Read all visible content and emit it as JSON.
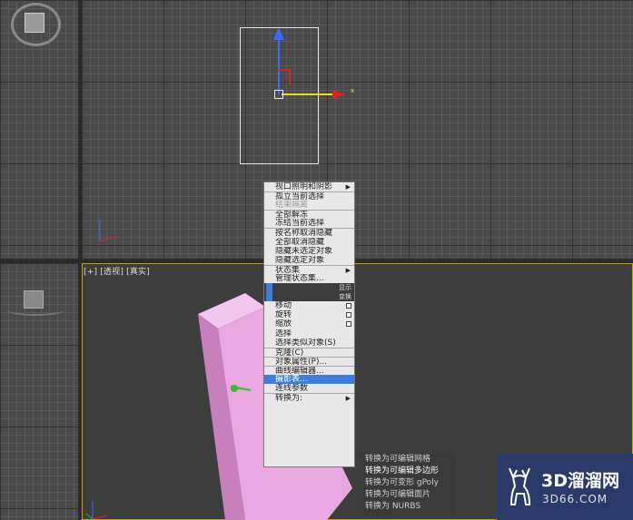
{
  "viewport_persp": {
    "label": "[+] [透视] [真实]"
  },
  "gizmo": {
    "x_label": "x"
  },
  "context_menu": {
    "items": [
      {
        "label": "视口照明和阴影",
        "submenu": true
      },
      {
        "label": "孤立当前选择"
      },
      {
        "label": "结束隔离",
        "disabled": true
      },
      {
        "label": "全部解冻"
      },
      {
        "label": "冻结当前选择"
      },
      {
        "label": "按名称取消隐藏"
      },
      {
        "label": "全部取消隐藏"
      },
      {
        "label": "隐藏未选定对象"
      },
      {
        "label": "隐藏选定对象"
      },
      {
        "label": "状态集",
        "submenu": true
      },
      {
        "label": "管理状态集..."
      },
      {
        "label": "显示"
      },
      {
        "label": "变换"
      },
      {
        "label": "移动"
      },
      {
        "label": "旋转"
      },
      {
        "label": "缩放"
      },
      {
        "label": "选择"
      },
      {
        "label": "选择类似对象(S)"
      },
      {
        "label": "克隆(C)"
      },
      {
        "label": "对象属性(P)..."
      },
      {
        "label": "曲线编辑器..."
      },
      {
        "label": "摄影表..."
      },
      {
        "label": "连线参数"
      },
      {
        "label": "转换为:",
        "submenu": true
      }
    ]
  },
  "convert_submenu": {
    "items": [
      {
        "label": "转换为可编辑网格"
      },
      {
        "label": "转换为可编辑多边形"
      },
      {
        "label": "转换为可变形 gPoly"
      },
      {
        "label": "转换为可编辑面片"
      },
      {
        "label": "转换为 NURBS"
      }
    ]
  },
  "watermark": {
    "title": "3D溜溜网",
    "url": "3D66.COM"
  },
  "colors": {
    "menu_bg": "#e8e8e8",
    "highlight": "#3c7ee0",
    "box": "#e9a7e0",
    "viewport_active_border": "#c8a000"
  }
}
